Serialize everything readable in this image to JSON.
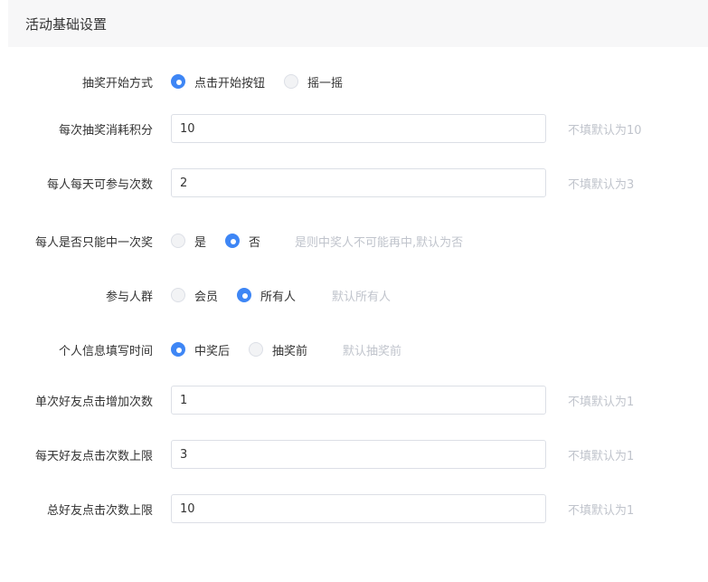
{
  "section": {
    "title": "活动基础设置"
  },
  "draw_start": {
    "label": "抽奖开始方式",
    "options": [
      {
        "label": "点击开始按钮",
        "checked": true
      },
      {
        "label": "摇一摇",
        "checked": false
      }
    ]
  },
  "points_per_draw": {
    "label": "每次抽奖消耗积分",
    "value": "10",
    "hint": "不填默认为10"
  },
  "daily_draws": {
    "label": "每人每天可参与次数",
    "value": "2",
    "hint": "不填默认为3"
  },
  "win_once": {
    "label": "每人是否只能中一次奖",
    "options": [
      {
        "label": "是",
        "checked": false
      },
      {
        "label": "否",
        "checked": true
      }
    ],
    "hint": "是则中奖人不可能再中,默认为否"
  },
  "audience": {
    "label": "参与人群",
    "options": [
      {
        "label": "会员",
        "checked": false
      },
      {
        "label": "所有人",
        "checked": true
      }
    ],
    "hint": "默认所有人"
  },
  "info_time": {
    "label": "个人信息填写时间",
    "options": [
      {
        "label": "中奖后",
        "checked": true
      },
      {
        "label": "抽奖前",
        "checked": false
      }
    ],
    "hint": "默认抽奖前"
  },
  "friend_click_add": {
    "label": "单次好友点击增加次数",
    "value": "1",
    "hint": "不填默认为1"
  },
  "daily_friend_click_limit": {
    "label": "每天好友点击次数上限",
    "value": "3",
    "hint": "不填默认为1"
  },
  "total_friend_click_limit": {
    "label": "总好友点击次数上限",
    "value": "10",
    "hint": "不填默认为1"
  }
}
